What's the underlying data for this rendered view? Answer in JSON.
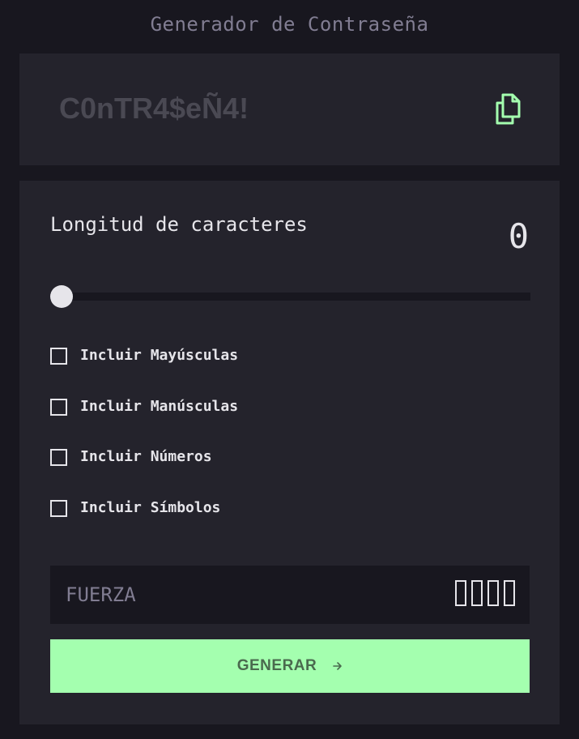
{
  "app": {
    "title": "Generador de Contraseña"
  },
  "password": {
    "value": "C0nTR4$eÑ4!",
    "copy_icon": "copy-icon"
  },
  "length": {
    "label": "Longitud de caracteres",
    "value": "0",
    "slider_fraction": 0
  },
  "options": [
    {
      "label": "Incluir Mayúsculas",
      "checked": false
    },
    {
      "label": "Incluir Manúsculas",
      "checked": false
    },
    {
      "label": "Incluir Números",
      "checked": false
    },
    {
      "label": "Incluir Símbolos",
      "checked": false
    }
  ],
  "strength": {
    "label": "FUERZA",
    "bars_filled": 0,
    "bars_total": 4
  },
  "generate": {
    "label": "GENERAR",
    "icon": "arrow-right-icon"
  },
  "colors": {
    "background": "#18171f",
    "panel": "#24232c",
    "accent": "#a4ffaf",
    "text": "#e6e5ea",
    "muted": "#817d92"
  }
}
